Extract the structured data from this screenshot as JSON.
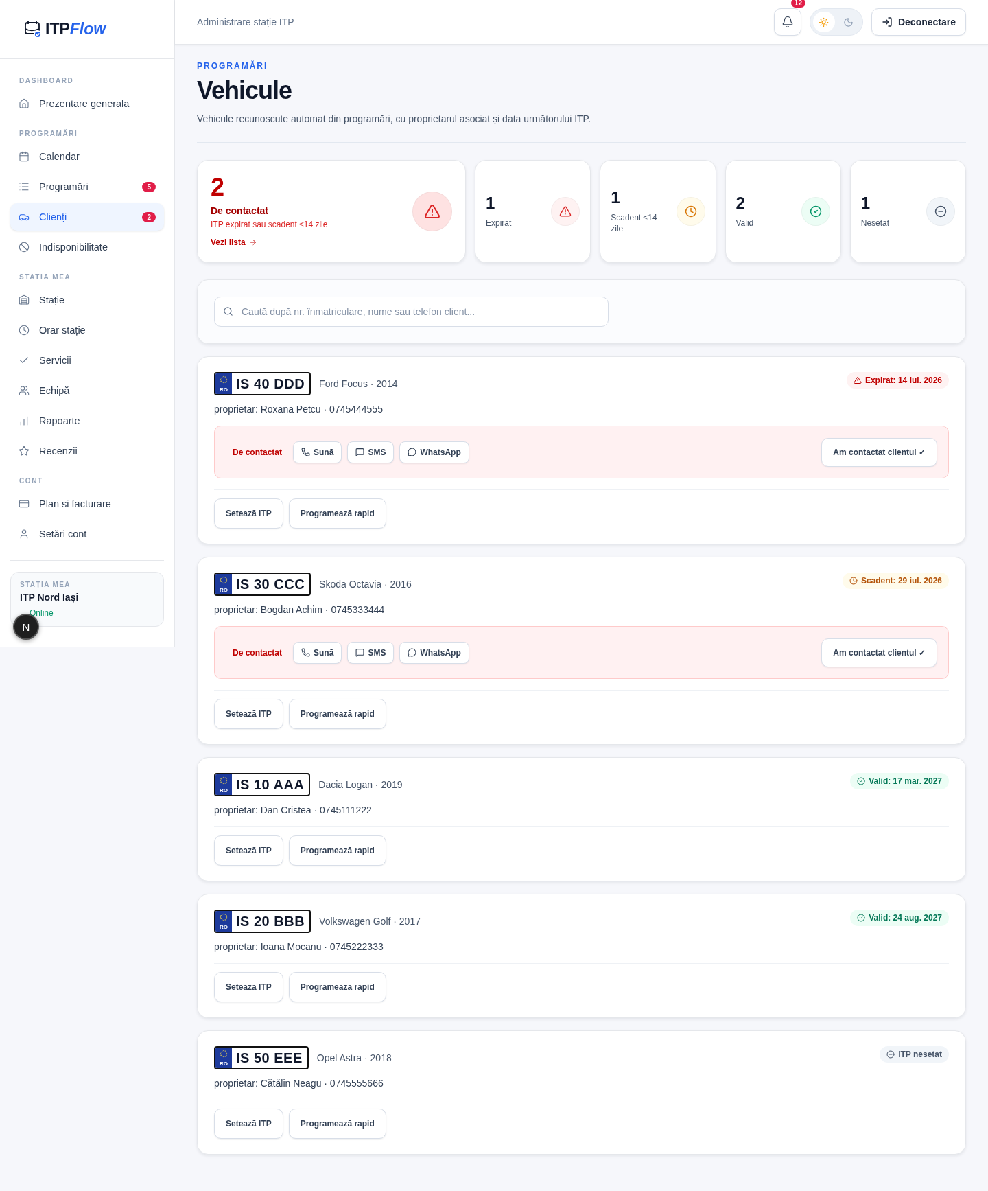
{
  "brand": {
    "part_1": "ITP",
    "part_2": "Flow"
  },
  "sidebar": {
    "sections": [
      {
        "title": "DASHBOARD",
        "items": [
          {
            "label": "Prezentare generala",
            "selected": false
          }
        ]
      },
      {
        "title": "PROGRAMĂRI",
        "items": [
          {
            "label": "Calendar",
            "selected": false
          },
          {
            "label": "Programări",
            "badge": "5",
            "selected": false
          },
          {
            "label": "Clienți",
            "badge": "2",
            "selected": true
          },
          {
            "label": "Indisponibilitate",
            "selected": false
          }
        ]
      },
      {
        "title": "STATIA MEA",
        "items": [
          {
            "label": "Stație",
            "selected": false
          },
          {
            "label": "Orar stație",
            "selected": false
          },
          {
            "label": "Servicii",
            "selected": false
          },
          {
            "label": "Echipă",
            "selected": false
          },
          {
            "label": "Rapoarte",
            "selected": false
          },
          {
            "label": "Recenzii",
            "selected": false
          }
        ]
      },
      {
        "title": "CONT",
        "items": [
          {
            "label": "Plan si facturare",
            "selected": false
          },
          {
            "label": "Setări cont",
            "selected": false
          }
        ]
      }
    ],
    "station_card": {
      "label": "STAȚIA MEA",
      "name": "ITP Nord Iași",
      "status": "Online"
    },
    "floating_badge": "N"
  },
  "header": {
    "title": "Administrare stație ITP",
    "notifications": "12",
    "theme_toggle": [
      {
        "kind": "light",
        "selected": true
      },
      {
        "kind": "dark",
        "selected": false
      }
    ],
    "logout": "Deconectare"
  },
  "page": {
    "eyebrow": "PROGRAMĂRI",
    "title": "Vehicule",
    "description": "Vehicule recunoscute automat din programări, cu proprietarul asociat și data următorului ITP."
  },
  "summary": {
    "count": "2",
    "title": "De contactat",
    "subtitle": "ITP expirat sau scadent ≤14 zile",
    "link": "Vezi lista"
  },
  "stats": [
    {
      "count": "1",
      "label": "Expirat",
      "kind": "expired"
    },
    {
      "count": "1",
      "label": "Scadent ≤14 zile",
      "kind": "due"
    },
    {
      "count": "2",
      "label": "Valid",
      "kind": "valid"
    },
    {
      "count": "1",
      "label": "Nesetat",
      "kind": "unset"
    }
  ],
  "search": {
    "placeholder": "Caută după nr. înmatriculare, nume sau telefon client..."
  },
  "vehicles": [
    {
      "country": "RO",
      "plate": "IS 40 DDD",
      "model": "Ford Focus · 2014",
      "owner": "proprietar: Roxana Petcu · 0745444555",
      "status": {
        "kind": "expired",
        "label": "Expirat: 14 iul. 2026"
      },
      "contact": {
        "label": "De contactat",
        "actions": [
          "Sună",
          "SMS",
          "WhatsApp"
        ],
        "done": "Am contactat clientul ✓"
      },
      "buttons": [
        "Setează ITP",
        "Programează rapid"
      ]
    },
    {
      "country": "RO",
      "plate": "IS 30 CCC",
      "model": "Skoda Octavia · 2016",
      "owner": "proprietar: Bogdan Achim · 0745333444",
      "status": {
        "kind": "due",
        "label": "Scadent: 29 iul. 2026"
      },
      "contact": {
        "label": "De contactat",
        "actions": [
          "Sună",
          "SMS",
          "WhatsApp"
        ],
        "done": "Am contactat clientul ✓"
      },
      "buttons": [
        "Setează ITP",
        "Programează rapid"
      ]
    },
    {
      "country": "RO",
      "plate": "IS 10 AAA",
      "model": "Dacia Logan · 2019",
      "owner": "proprietar: Dan Cristea · 0745111222",
      "status": {
        "kind": "valid",
        "label": "Valid: 17 mar. 2027"
      },
      "buttons": [
        "Setează ITP",
        "Programează rapid"
      ]
    },
    {
      "country": "RO",
      "plate": "IS 20 BBB",
      "model": "Volkswagen Golf · 2017",
      "owner": "proprietar: Ioana Mocanu · 0745222333",
      "status": {
        "kind": "valid",
        "label": "Valid: 24 aug. 2027"
      },
      "buttons": [
        "Setează ITP",
        "Programează rapid"
      ]
    },
    {
      "country": "RO",
      "plate": "IS 50 EEE",
      "model": "Opel Astra · 2018",
      "owner": "proprietar: Cătălin Neagu · 0745555666",
      "status": {
        "kind": "unset",
        "label": "ITP nesetat"
      },
      "buttons": [
        "Setează ITP",
        "Programează rapid"
      ]
    }
  ]
}
